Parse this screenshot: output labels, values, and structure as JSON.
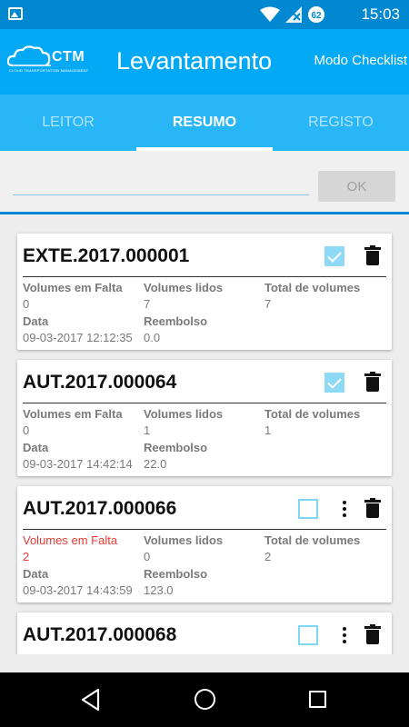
{
  "status_bar": {
    "time": "15:03",
    "battery_level": "62",
    "icons": [
      "image-icon",
      "wifi-icon",
      "signal-icon",
      "battery-icon"
    ]
  },
  "app_bar": {
    "logo_text": "CTM",
    "logo_subtitle": "CLOUD TRANSPORTATION MANAGEMENT",
    "title": "Levantamento",
    "mode_label": "Modo Checklist"
  },
  "tabs": [
    {
      "label": "LEITOR",
      "active": false
    },
    {
      "label": "RESUMO",
      "active": true
    },
    {
      "label": "REGISTO",
      "active": false
    }
  ],
  "search": {
    "value": "",
    "placeholder": "",
    "ok_label": "OK"
  },
  "labels": {
    "missing": "Volumes em Falta",
    "read": "Volumes lidos",
    "total": "Total de volumes",
    "date": "Data",
    "refund": "Reembolso"
  },
  "items": [
    {
      "code": "EXTE.2017.000001",
      "missing": "0",
      "read": "7",
      "total": "7",
      "date": "09-03-2017 12:12:35",
      "refund": "0.0",
      "checked": true,
      "has_more": false,
      "alert": false
    },
    {
      "code": "AUT.2017.000064",
      "missing": "0",
      "read": "1",
      "total": "1",
      "date": "09-03-2017 14:42:14",
      "refund": "22.0",
      "checked": true,
      "has_more": false,
      "alert": false
    },
    {
      "code": "AUT.2017.000066",
      "missing": "2",
      "read": "0",
      "total": "2",
      "date": "09-03-2017 14:43:59",
      "refund": "123.0",
      "checked": false,
      "has_more": true,
      "alert": true
    },
    {
      "code": "AUT.2017.000068",
      "checked": false,
      "has_more": true
    }
  ],
  "colors": {
    "primary_dark": "#0288d1",
    "primary": "#03a9f4",
    "tabs": "#29b6f6",
    "alert": "#e53935",
    "checkbox": "#8ed9f6"
  }
}
